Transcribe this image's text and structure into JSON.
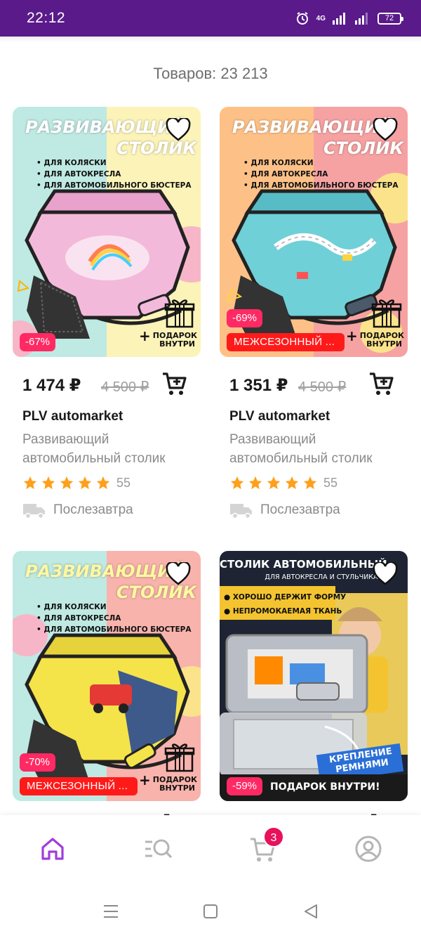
{
  "status_bar": {
    "time": "22:12",
    "network": "4G",
    "battery": "72"
  },
  "catalog": {
    "count_label": "Товаров: 23 213"
  },
  "products": [
    {
      "price": "1 474 ₽",
      "old_price": "4 500 ₽",
      "brand": "PLV automarket",
      "desc_line1": "Развивающий",
      "desc_line2": "автомобильный столик",
      "rating_count": "55",
      "delivery": "Послезавтра",
      "discount": "-67%",
      "season_label": "",
      "image": {
        "title_line1": "РАЗВИВАЮЩИЙ",
        "title_line2": "СТОЛИК",
        "bullet1": "• ДЛЯ КОЛЯСКИ",
        "bullet2": "• ДЛЯ АВТОКРЕСЛА",
        "bullet3": "• ДЛЯ АВТОМОБИЛЬНОГО БЮСТЕРА",
        "gift_line1": "ПОДАРОК",
        "gift_line2": "ВНУТРИ"
      }
    },
    {
      "price": "1 351 ₽",
      "old_price": "4 500 ₽",
      "brand": "PLV automarket",
      "desc_line1": "Развивающий",
      "desc_line2": "автомобильный столик",
      "rating_count": "55",
      "delivery": "Послезавтра",
      "discount": "-69%",
      "season_label": "МЕЖСЕЗОННЫЙ ...",
      "image": {
        "title_line1": "РАЗВИВАЮЩИЙ",
        "title_line2": "СТОЛИК",
        "bullet1": "• ДЛЯ КОЛЯСКИ",
        "bullet2": "• ДЛЯ АВТОКРЕСЛА",
        "bullet3": "• ДЛЯ АВТОМОБИЛЬНОГО БЮСТЕРА",
        "gift_line1": "ПОДАРОК",
        "gift_line2": "ВНУТРИ"
      }
    },
    {
      "discount": "-70%",
      "season_label": "МЕЖСЕЗОННЫЙ ...",
      "image": {
        "title_line1": "РАЗВИВАЮЩИЙ",
        "title_line2": "СТОЛИК",
        "bullet1": "• ДЛЯ КОЛЯСКИ",
        "bullet2": "• ДЛЯ АВТОКРЕСЛА",
        "bullet3": "• ДЛЯ АВТОМОБИЛЬНОГО БЮСТЕРА",
        "gift_line1": "ПОДАРОК",
        "gift_line2": "ВНУТРИ"
      }
    },
    {
      "discount": "-59%",
      "image": {
        "title": "СТОЛИК АВТОМОБИЛЬНЫЙ",
        "subtitle": "ДЛЯ АВТОКРЕСЛА И СТУЛЬЧИКА",
        "feature1": "ХОРОШО ДЕРЖИТ ФОРМУ",
        "feature2": "НЕПРОМОКАЕМАЯ ТКАНЬ",
        "mount_line1": "КРЕПЛЕНИЕ",
        "mount_line2": "РЕМНЯМИ",
        "gift_banner": "ПОДАРОК ВНУТРИ!"
      }
    }
  ],
  "bottom_nav": {
    "cart_badge": "3",
    "active_item": "home"
  },
  "colors": {
    "status_bar": "#5a1a8a",
    "brand_purple": "#a13ddb",
    "discount_pink": "#ff2a63",
    "season_red": "#ff1a1a",
    "star_orange": "#ff9f1a",
    "badge_pink": "#e8115b"
  },
  "icons": [
    "alarm-icon",
    "signal-icon",
    "battery-icon",
    "heart-icon",
    "gift-icon",
    "cart-icon",
    "star-icon",
    "delivery-truck-icon",
    "home-icon",
    "catalog-search-icon",
    "user-icon",
    "menu-icon",
    "square-icon",
    "back-icon"
  ]
}
